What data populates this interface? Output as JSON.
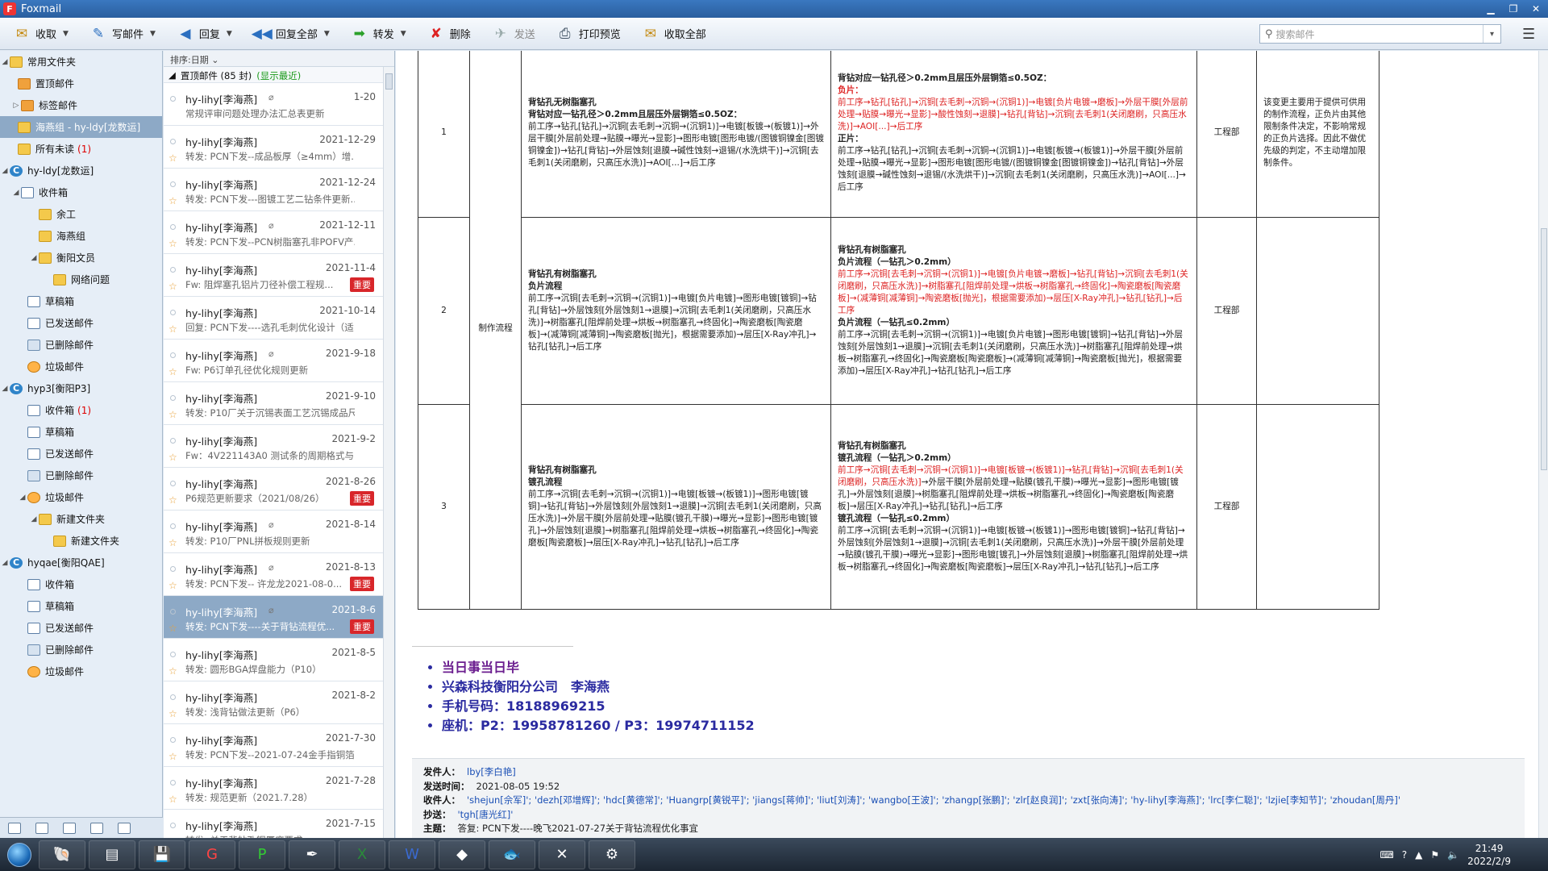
{
  "window": {
    "title": "Foxmail"
  },
  "toolbar": {
    "receive": "收取",
    "compose": "写邮件",
    "reply": "回复",
    "reply_all": "回复全部",
    "forward": "转发",
    "delete": "删除",
    "send": "发送",
    "print_preview": "打印预览",
    "receive_all": "收取全部",
    "search_placeholder": "搜索邮件"
  },
  "sidebar": {
    "common": "常用文件夹",
    "pinned": "置顶邮件",
    "tags": "标签邮件",
    "selected_folder": "海燕组 - hy-ldy[龙数运]",
    "unread": "所有未读",
    "unread_count": "(1)",
    "acct1": "hy-ldy[龙数运]",
    "acct1_inbox": "收件箱",
    "acct1_yugong": "余工",
    "acct1_haiyan": "海燕组",
    "acct1_hengyang": "衡阳文员",
    "acct1_network": "网络问题",
    "acct1_drafts": "草稿箱",
    "acct1_sent": "已发送邮件",
    "acct1_deleted": "已删除邮件",
    "acct1_spam": "垃圾邮件",
    "acct2": "hyp3[衡阳P3]",
    "acct2_inbox": "收件箱",
    "acct2_inbox_count": "(1)",
    "acct2_drafts": "草稿箱",
    "acct2_sent": "已发送邮件",
    "acct2_deleted": "已删除邮件",
    "acct2_spam": "垃圾邮件",
    "acct2_newfolder": "新建文件夹",
    "acct2_newfolder2": "新建文件夹",
    "acct3": "hyqae[衡阳QAE]",
    "acct3_inbox": "收件箱",
    "acct3_drafts": "草稿箱",
    "acct3_sent": "已发送邮件",
    "acct3_deleted": "已删除邮件",
    "acct3_spam": "垃圾邮件"
  },
  "maillist": {
    "sort": "排序:日期",
    "group": "置顶邮件 (85 封)",
    "group_show": "(显示最近)",
    "important": "重要",
    "items": [
      {
        "from": "hy-lihy[李海燕]",
        "date": "1-20",
        "subj": "常规评审问题处理办法汇总表更新"
      },
      {
        "from": "hy-lihy[李海燕]",
        "date": "2021-12-29",
        "subj": "转发: PCN下发--成品板厚（≥4mm）增..."
      },
      {
        "from": "hy-lihy[李海燕]",
        "date": "2021-12-24",
        "subj": "转发: PCN下发---图镀工艺二钻条件更新..."
      },
      {
        "from": "hy-lihy[李海燕]",
        "date": "2021-12-11",
        "subj": "转发: PCN下发--PCN树脂塞孔非POFV产..."
      },
      {
        "from": "hy-lihy[李海燕]",
        "date": "2021-11-4",
        "subj": "Fw: 阻焊塞孔铝片刀径补偿工程规..."
      },
      {
        "from": "hy-lihy[李海燕]",
        "date": "2021-10-14",
        "subj": "回复: PCN下发----选孔毛刺优化设计（适..."
      },
      {
        "from": "hy-lihy[李海燕]",
        "date": "2021-9-18",
        "subj": "Fw: P6订单孔径优化规则更新"
      },
      {
        "from": "hy-lihy[李海燕]",
        "date": "2021-9-10",
        "subj": "转发: P10厂关于沉锡表面工艺沉锡成品尺..."
      },
      {
        "from": "hy-lihy[李海燕]",
        "date": "2021-9-2",
        "subj": "Fw：4V221143A0 测试条的周期格式与..."
      },
      {
        "from": "hy-lihy[李海燕]",
        "date": "2021-8-26",
        "subj": "P6规范更新要求（2021/08/26）"
      },
      {
        "from": "hy-lihy[李海燕]",
        "date": "2021-8-14",
        "subj": "转发: P10厂PNL拼板规则更新"
      },
      {
        "from": "hy-lihy[李海燕]",
        "date": "2021-8-13",
        "subj": "转发: PCN下发-- 许龙龙2021-08-0..."
      },
      {
        "from": "hy-lihy[李海燕]",
        "date": "2021-8-6",
        "subj": "转发: PCN下发----关于背钻流程优..."
      },
      {
        "from": "hy-lihy[李海燕]",
        "date": "2021-8-5",
        "subj": "转发: 圆形BGA焊盘能力（P10）"
      },
      {
        "from": "hy-lihy[李海燕]",
        "date": "2021-8-2",
        "subj": "转发: 浅背钻做法更新（P6）"
      },
      {
        "from": "hy-lihy[李海燕]",
        "date": "2021-7-30",
        "subj": "转发: PCN下发--2021-07-24金手指铜箔..."
      },
      {
        "from": "hy-lihy[李海燕]",
        "date": "2021-7-28",
        "subj": "转发: 规范更新（2021.7.28）"
      },
      {
        "from": "hy-lihy[李海燕]",
        "date": "2021-7-15",
        "subj": "转发: 关于背钻孔铜厚度要求，..."
      }
    ]
  },
  "table": {
    "row1": {
      "no": "1",
      "old_title1": "背钻孔无树脂塞孔",
      "old_title2": "背钻对应一钻孔径＞0.2mm且层压外层铜箔≤0.5OZ：",
      "old_body": "前工序→钻孔[钻孔]→沉铜[去毛刺→沉铜→(沉铜1)]→电镀[板镀→(板镀1)]→外层干膜[外层前处理→贴膜→曝光→显影]→图形电镀[图形电镀/(图镀铜镍金[图镀铜镍金])→钻孔[背钻]→外层蚀刻[退膜→碱性蚀刻→退锡/(水洗烘干)]→沉铜[去毛刺1(关闭磨刷，只高压水洗)]→AOI[...]→后工序",
      "new_title": "背钻对应一钻孔径＞0.2mm且层压外层铜箔≤0.5OZ：",
      "neg_label": "负片：",
      "neg_body": "前工序→钻孔[钻孔]→沉铜[去毛刺→沉铜→(沉铜1)]→电镀[负片电镀→磨板]→外层干膜[外层前处理→贴膜→曝光→显影]→酸性蚀刻→退膜]→钻孔[背钻]→沉铜[去毛刺1(关闭磨刷，只高压水洗)]→AOI[...]→后工序",
      "pos_label": "正片：",
      "pos_body": "前工序→钻孔[钻孔]→沉铜[去毛刺→沉铜→(沉铜1)]→电镀[板镀→(板镀1)]→外层干膜[外层前处理→贴膜→曝光→显影]→图形电镀[图形电镀/(图镀铜镍金[图镀铜镍金])→钻孔[背钻]→外层蚀刻[退膜→碱性蚀刻→退锡/(水洗烘干)]→沉铜[去毛刺1(关闭磨刷，只高压水洗)]→AOI[...]→后工序",
      "dept": "工程部",
      "note": "该变更主要用于提供可供用的制作流程，正负片由其他限制条件决定，不影响常规的正负片选择。因此不做优先级的判定，不主动增加限制条件。"
    },
    "row2": {
      "no": "2",
      "cat": "制作流程",
      "old_title1": "背钻孔有树脂塞孔",
      "old_title2": "负片流程",
      "old_body": "前工序→沉铜[去毛刺→沉铜→(沉铜1)]→电镀[负片电镀]→图形电镀[镀铜]→钻孔[背钻]→外层蚀刻[外层蚀刻1→退膜]→沉铜[去毛刺1(关闭磨刷，只高压水洗)]→树脂塞孔[阻焊前处理→烘板→树脂塞孔→终固化]→陶瓷磨板[陶瓷磨板]→(减薄铜[减薄铜]→陶瓷磨板[抛光]，根据需要添加)→层压[X-Ray冲孔]→钻孔[钻孔]→后工序",
      "new_title1": "背钻孔有树脂塞孔",
      "new_title2": "负片流程（一钻孔＞0.2mm）",
      "new_red": "前工序→沉铜[去毛刺→沉铜→(沉铜1)]→电镀[负片电镀→磨板]→钻孔[背钻]→沉铜[去毛刺1(关闭磨刷，只高压水洗)]→树脂塞孔[阻焊前处理→烘板→树脂塞孔→终固化]→陶瓷磨板[陶瓷磨板]→(减薄铜[减薄铜]→陶瓷磨板[抛光]，根据需要添加)→层压[X-Ray冲孔]→钻孔[钻孔]→后工序",
      "new_title3": "负片流程（一钻孔≤0.2mm）",
      "new_black": "前工序→沉铜[去毛刺→沉铜→(沉铜1)]→电镀[负片电镀]→图形电镀[镀铜]→钻孔[背钻]→外层蚀刻[外层蚀刻1→退膜]→沉铜[去毛刺1(关闭磨刷，只高压水洗)]→树脂塞孔[阻焊前处理→烘板→树脂塞孔→终固化]→陶瓷磨板[陶瓷磨板]→(减薄铜[减薄铜]→陶瓷磨板[抛光]，根据需要添加)→层压[X-Ray冲孔]→钻孔[钻孔]→后工序",
      "dept": "工程部"
    },
    "row3": {
      "no": "3",
      "old_title1": "背钻孔有树脂塞孔",
      "old_title2": "镀孔流程",
      "old_body": "前工序→沉铜[去毛刺→沉铜→(沉铜1)]→电镀[板镀→(板镀1)]→图形电镀[镀铜]→钻孔[背钻]→外层蚀刻[外层蚀刻1→退膜]→沉铜[去毛刺1(关闭磨刷，只高压水洗)]→外层干膜[外层前处理→贴膜(镀孔干膜)→曝光→显影]→图形电镀[镀孔]→外层蚀刻[退膜]→树脂塞孔[阻焊前处理→烘板→树脂塞孔→终固化]→陶瓷磨板[陶瓷磨板]→层压[X-Ray冲孔]→钻孔[钻孔]→后工序",
      "new_title1": "背钻孔有树脂塞孔",
      "new_title2": "镀孔流程（一钻孔＞0.2mm）",
      "new_red": "前工序→沉铜[去毛刺→沉铜→(沉铜1)]→电镀[板镀→(板镀1)]→钻孔[背钻]→沉铜[去毛刺1(关闭磨刷，只高压水洗)]",
      "new_red_tail": "→外层干膜[外层前处理→贴膜(镀孔干膜)→曝光→显影]→图形电镀[镀孔]→外层蚀刻[退膜]→树脂塞孔[阻焊前处理→烘板→树脂塞孔→终固化]→陶瓷磨板[陶瓷磨板]→层压[X-Ray冲孔]→钻孔[钻孔]→后工序",
      "new_title3": "镀孔流程（一钻孔≤0.2mm）",
      "new_black": "前工序→沉铜[去毛刺→沉铜→(沉铜1)]→电镀[板镀→(板镀1)]→图形电镀[镀铜]→钻孔[背钻]→外层蚀刻[外层蚀刻1→退膜]→沉铜[去毛刺1(关闭磨刷，只高压水洗)]→外层干膜[外层前处理→贴膜(镀孔干膜)→曝光→显影]→图形电镀[镀孔]→外层蚀刻[退膜]→树脂塞孔[阻焊前处理→烘板→树脂塞孔→终固化]→陶瓷磨板[陶瓷磨板]→层压[X-Ray冲孔]→钻孔[钻孔]→后工序",
      "dept": "工程部"
    }
  },
  "signature": {
    "line1": "当日事当日毕",
    "line2": "兴森科技衡阳分公司　李海燕",
    "line3": "手机号码：18188969215",
    "line4": "座机：P2：19958781260 / P3：19974711152"
  },
  "meta": {
    "from_label": "发件人：",
    "from": "lby[李白艳]",
    "time_label": "发送时间：",
    "time": "2021-08-05 19:52",
    "to_label": "收件人：",
    "to": "'shejun[佘军]'; 'dezh[邓增辉]'; 'hdc[黄德常]'; 'Huangrp[黄锐平]'; 'jiangs[蒋帅]'; 'liut[刘涛]'; 'wangbo[王波]'; 'zhangp[张鹏]'; 'zlr[赵良润]'; 'zxt[张向涛]'; 'hy-lihy[李海燕]'; 'lrc[李仁聪]'; 'lzjie[李知节]'; 'zhoudan[周丹]'",
    "cc_label": "抄送：",
    "cc": "'tgh[唐光红]'",
    "subj_label": "主题：",
    "subj": "答复: PCN下发----晚飞2021-07-27关于背钻流程优化事宜"
  },
  "taskbar": {
    "time": "21:49",
    "date": "2022/2/9"
  },
  "colors": {
    "accent": "#8da9c6",
    "important": "#d8262a",
    "arrow": "#22e022"
  }
}
